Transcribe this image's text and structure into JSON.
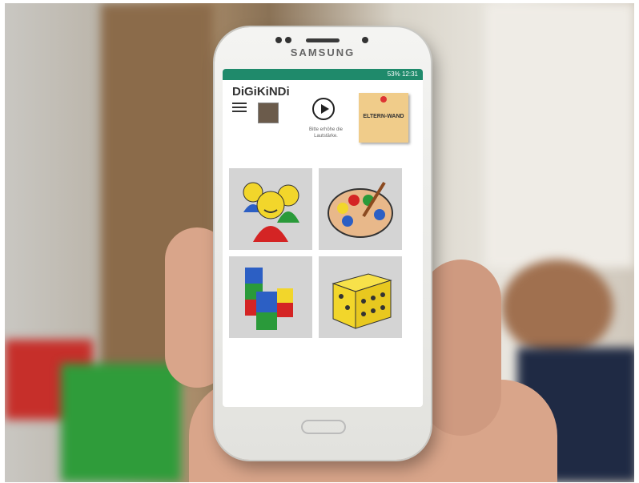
{
  "phone": {
    "brand": "SAMSUNG",
    "status": "53% 12:31"
  },
  "app": {
    "logo": "DiGiKiNDi",
    "volume_hint": "Bitte erhöhe die Lautstärke.",
    "parent_board": "ELTERN-WAND"
  },
  "tiles": [
    {
      "icon": "group-faces-icon"
    },
    {
      "icon": "paint-palette-icon"
    },
    {
      "icon": "building-blocks-icon"
    },
    {
      "icon": "dice-icon"
    }
  ]
}
